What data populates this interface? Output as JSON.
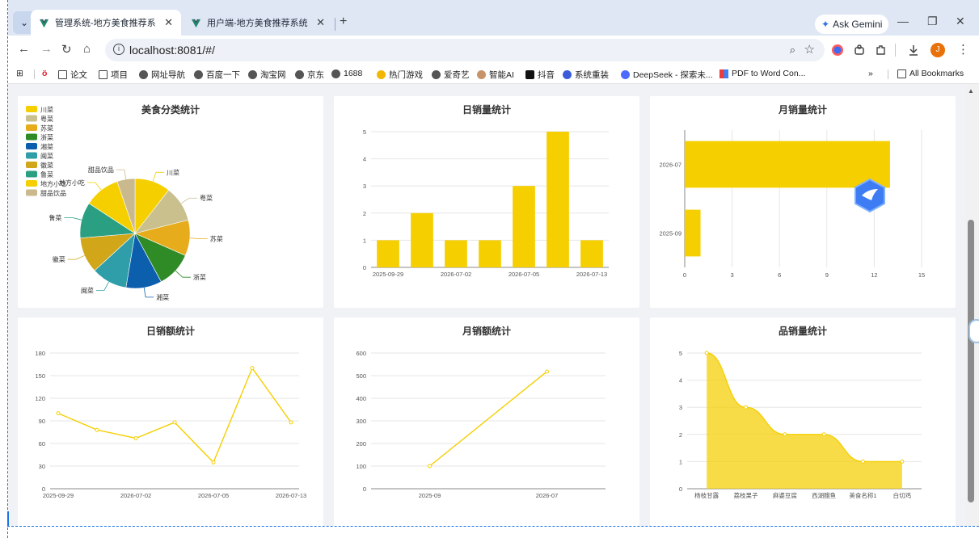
{
  "tabs": [
    {
      "title": "管理系统-地方美食推荐系统",
      "active": true
    },
    {
      "title": "用户端-地方美食推荐系统",
      "active": false
    }
  ],
  "gemini_label": "Ask Gemini",
  "address": {
    "url": "localhost:8081/#/"
  },
  "avatar_letter": "J",
  "bookmarks": [
    "论文",
    "项目",
    "网址导航",
    "百度一下",
    "淘宝网",
    "京东",
    "1688",
    "热门游戏",
    "爱奇艺",
    "智能AI",
    "抖音",
    "系统重装",
    "DeepSeek - 探索未...",
    "PDF to Word Con..."
  ],
  "all_bookmarks": "All Bookmarks",
  "charts": {
    "pie_title": "美食分类统计",
    "daily_sales_title": "日销量统计",
    "monthly_sales_title": "月销量统计",
    "daily_revenue_title": "日销额统计",
    "monthly_revenue_title": "月销额统计",
    "product_sales_title": "品销量统计"
  },
  "colors": {
    "accent": "#f5cf00",
    "tab_strip": "#dfe7f5"
  },
  "chart_data": [
    {
      "type": "pie",
      "title": "美食分类统计",
      "categories": [
        "川菜",
        "粤菜",
        "苏菜",
        "浙菜",
        "湘菜",
        "闽菜",
        "徽菜",
        "鲁菜",
        "地方小吃",
        "甜品饮品"
      ],
      "values": [
        1,
        1,
        1,
        1,
        1,
        1,
        1,
        1,
        1,
        0.5
      ],
      "colors": [
        "#f5cf00",
        "#c9c08e",
        "#e6ac1c",
        "#2e8b26",
        "#0b5fad",
        "#2f9ea8",
        "#d1a619",
        "#2a9f82",
        "#f5cf00",
        "#cbb98e"
      ],
      "legend": "top-left"
    },
    {
      "type": "bar",
      "title": "日销量统计",
      "categories": [
        "2025-09-29",
        "",
        "2026-07-02",
        "",
        "2026-07-05",
        "",
        "2026-07-13"
      ],
      "values": [
        1,
        2,
        1,
        1,
        3,
        5,
        1
      ],
      "ylim": [
        0,
        5
      ],
      "yticks": [
        "0",
        "1",
        "2",
        "3",
        "4",
        "5"
      ]
    },
    {
      "type": "bar",
      "orientation": "horizontal",
      "title": "月销量统计",
      "categories": [
        "2025-09",
        "2026-07"
      ],
      "values": [
        1,
        13
      ],
      "xlim": [
        0,
        15
      ],
      "xticks": [
        "0",
        "3",
        "6",
        "9",
        "12",
        "15"
      ]
    },
    {
      "type": "line",
      "title": "日销额统计",
      "categories": [
        "2025-09-29",
        "",
        "2026-07-02",
        "",
        "2026-07-05",
        "",
        "2026-07-13"
      ],
      "values": [
        100,
        78,
        67,
        88,
        35,
        160,
        88
      ],
      "ylim": [
        0,
        180
      ],
      "yticks": [
        "0",
        "30",
        "60",
        "90",
        "120",
        "150",
        "180"
      ]
    },
    {
      "type": "line",
      "title": "月销额统计",
      "categories": [
        "2025-09",
        "2026-07"
      ],
      "values": [
        100,
        518
      ],
      "ylim": [
        0,
        600
      ],
      "yticks": [
        "0",
        "100",
        "200",
        "300",
        "400",
        "500",
        "600"
      ]
    },
    {
      "type": "area",
      "title": "品销量统计",
      "categories": [
        "杨枝甘露",
        "荔枝果子",
        "麻婆豆腐",
        "西湖醋鱼",
        "美食名称1",
        "白切鸡"
      ],
      "values": [
        5,
        3,
        2,
        2,
        1,
        1
      ],
      "ylim": [
        0,
        5
      ],
      "yticks": [
        "0",
        "1",
        "2",
        "3",
        "4",
        "5"
      ]
    }
  ]
}
